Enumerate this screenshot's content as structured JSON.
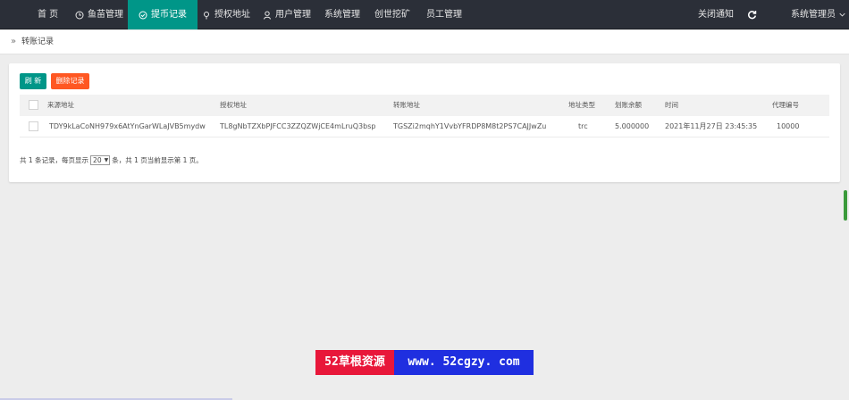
{
  "topnav": {
    "items": [
      {
        "label": "首 页",
        "icon": ""
      },
      {
        "label": "鱼苗管理",
        "icon": "clock-icon"
      },
      {
        "label": "提币记录",
        "icon": "check-circle-icon",
        "active": true
      },
      {
        "label": "授权地址",
        "icon": "pin-icon"
      },
      {
        "label": "用户管理",
        "icon": "user-icon"
      },
      {
        "label": "系统管理",
        "icon": ""
      },
      {
        "label": "创世挖矿",
        "icon": ""
      },
      {
        "label": "员工管理",
        "icon": ""
      }
    ],
    "close_notice": "关闭通知",
    "refresh_icon": "refresh-icon",
    "admin": "系统管理员",
    "admin_caret": "chevron-down-icon"
  },
  "breadcrumb": {
    "chevron": "»",
    "title": "转账记录"
  },
  "toolbar": {
    "refresh_label": "刷 新",
    "delete_label": "删除记录"
  },
  "table": {
    "headers": [
      "来源地址",
      "授权地址",
      "转账地址",
      "地址类型",
      "划账余额",
      "时间",
      "代理编号"
    ],
    "rows": [
      [
        "TDY9kLaCoNH979x6AtYnGarWLaJVB5mydw",
        "TL8gNbTZXbPJFCC3ZZQZWjCE4mLruQ3bsp",
        "TGSZi2mqhY1VvbYFRDP8M8t2PS7CAJJwZu",
        "trc",
        "5.000000",
        "2021年11月27日 23:45:35",
        "10000"
      ]
    ]
  },
  "pager": {
    "prefix": "共 1 条记录，每页显示",
    "page_size": "20",
    "suffix": "条，共 1 页当前显示第 1 页。"
  },
  "watermark": {
    "left": "52草根资源",
    "right": "www. 52cgzy. com"
  },
  "colors": {
    "topbar": "#2b2f38",
    "active": "#009688",
    "delete": "#ff5722"
  }
}
